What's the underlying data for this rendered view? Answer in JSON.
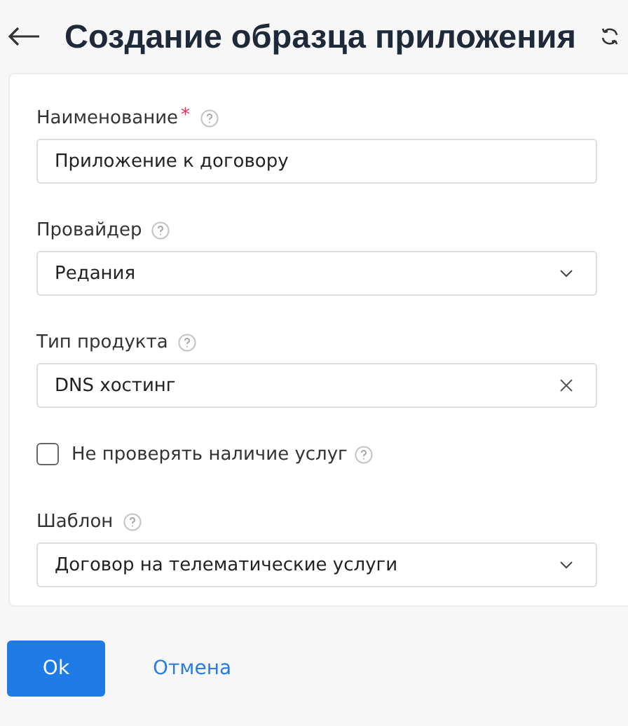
{
  "header": {
    "title": "Создание образца приложения"
  },
  "fields": [
    {
      "kind": "text",
      "label": "Наименование",
      "required_mark": "*",
      "value": "Приложение к договору"
    },
    {
      "kind": "select",
      "label": "Провайдер",
      "value": "Редания"
    },
    {
      "kind": "clearable",
      "label": "Тип продукта",
      "value": "DNS хостинг"
    },
    {
      "kind": "checkbox",
      "label": "Не проверять наличие услуг",
      "checked": false
    },
    {
      "kind": "select",
      "label": "Шаблон",
      "value": "Договор на телематические услуги"
    }
  ],
  "buttons": [
    {
      "kind": "primary",
      "label": "Ok"
    },
    {
      "kind": "link",
      "label": "Отмена"
    }
  ]
}
